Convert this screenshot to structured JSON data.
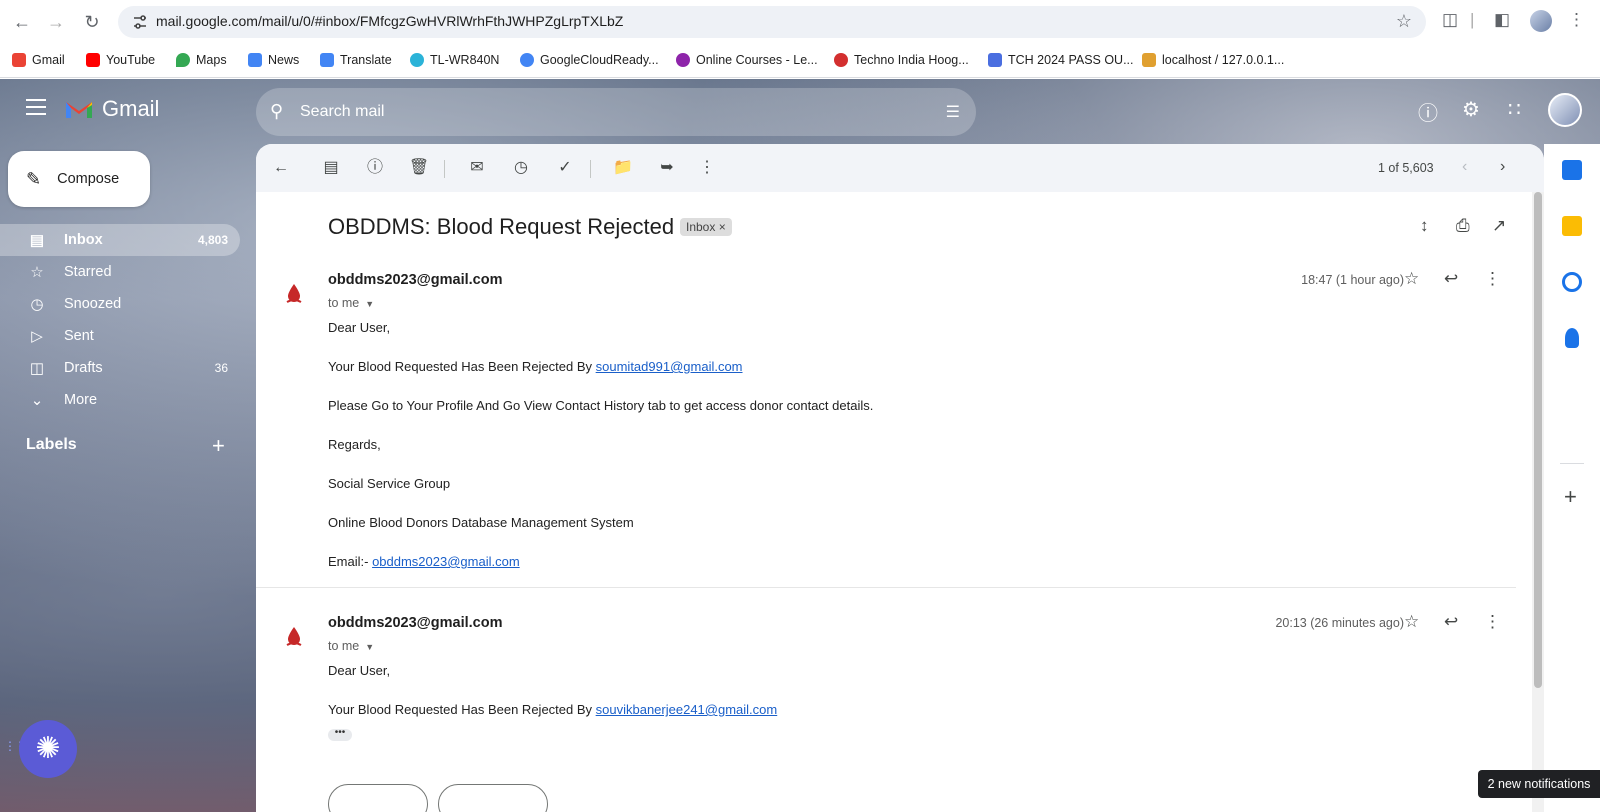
{
  "browser": {
    "url": "mail.google.com/mail/u/0/#inbox/FMfcgzGwHVRlWrhFthJWHPZgLrpTXLbZ",
    "bookmarks": [
      {
        "label": "Gmail",
        "icon": "gmail-icon",
        "color": "#ea4335"
      },
      {
        "label": "YouTube",
        "icon": "youtube-icon",
        "color": "#ff0000"
      },
      {
        "label": "Maps",
        "icon": "maps-icon",
        "color": "#34a853"
      },
      {
        "label": "News",
        "icon": "news-icon",
        "color": "#4285f4"
      },
      {
        "label": "Translate",
        "icon": "translate-icon",
        "color": "#4285f4"
      },
      {
        "label": "TL-WR840N",
        "icon": "tplink-icon",
        "color": "#2bb3d8"
      },
      {
        "label": "GoogleCloudReady...",
        "icon": "google-icon",
        "color": "#4285f4"
      },
      {
        "label": "Online Courses - Le...",
        "icon": "courses-icon",
        "color": "#8e24aa"
      },
      {
        "label": "Techno India Hoog...",
        "icon": "college-icon",
        "color": "#d32f2f"
      },
      {
        "label": "TCH 2024 PASS OU...",
        "icon": "group-icon",
        "color": "#4a6ee0"
      },
      {
        "label": "localhost / 127.0.0.1...",
        "icon": "phpmyadmin-icon",
        "color": "#e0a030"
      }
    ]
  },
  "gmail": {
    "brand": "Gmail",
    "search_placeholder": "Search mail",
    "compose_label": "Compose",
    "nav": [
      {
        "label": "Inbox",
        "count": "4,803",
        "icon": "inbox-icon"
      },
      {
        "label": "Starred",
        "count": "",
        "icon": "star-icon"
      },
      {
        "label": "Snoozed",
        "count": "",
        "icon": "clock-icon"
      },
      {
        "label": "Sent",
        "count": "",
        "icon": "send-icon"
      },
      {
        "label": "Drafts",
        "count": "36",
        "icon": "draft-icon"
      },
      {
        "label": "More",
        "count": "",
        "icon": "chevron-down-icon"
      }
    ],
    "labels_heading": "Labels",
    "counter": "1 of 5,603",
    "notification_toast": "2 new notifications"
  },
  "thread": {
    "subject": "OBDDMS: Blood Request Rejected",
    "chip": "Inbox",
    "messages": [
      {
        "sender": "obddms2023@gmail.com",
        "to": "to me",
        "time": "18:47 (1 hour ago)",
        "greeting": "Dear User,",
        "rejected_prefix": "Your Blood Requested Has Been Rejected By ",
        "rejected_by": "soumitad991@gmail.com",
        "instruction": "Please Go to Your Profile And Go View Contact History tab to get access donor contact details.",
        "regards": "Regards,",
        "group": "Social Service Group",
        "system": "Online Blood Donors Database Management System",
        "email_prefix": "Email:- ",
        "email": "obddms2023@gmail.com"
      },
      {
        "sender": "obddms2023@gmail.com",
        "to": "to me",
        "time": "20:13 (26 minutes ago)",
        "greeting": "Dear User,",
        "rejected_prefix": "Your Blood Requested Has Been Rejected By ",
        "rejected_by": "souvikbanerjee241@gmail.com"
      }
    ]
  }
}
